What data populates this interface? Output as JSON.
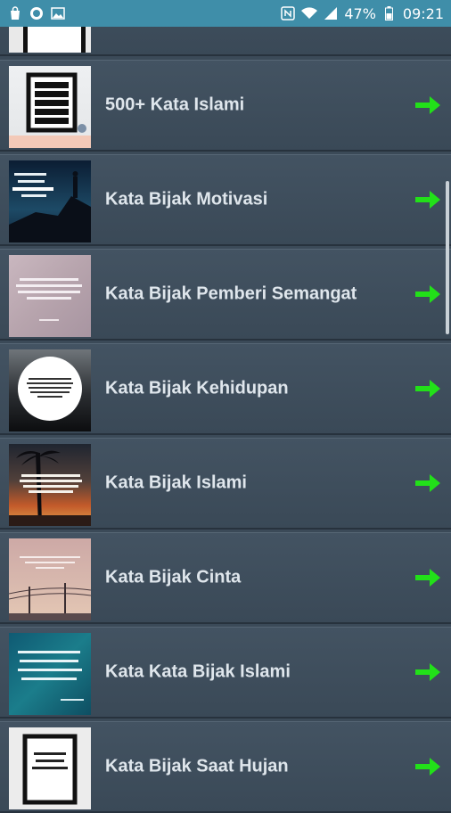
{
  "status_bar": {
    "battery_percent": "47%",
    "time": "09:21",
    "left_icons": [
      "shopping-bag-icon",
      "badge-icon",
      "image-icon"
    ],
    "right_icons": [
      "nfc-icon",
      "wifi-icon",
      "signal-icon",
      "battery-icon"
    ]
  },
  "list": {
    "items": [
      {
        "label": "500+ Kata Islami",
        "thumb": "kerja-kerja-poster"
      },
      {
        "label": "Kata Bijak Motivasi",
        "thumb": "silhouette-mountain"
      },
      {
        "label": "Kata Bijak Pemberi Semangat",
        "thumb": "pastel-quote"
      },
      {
        "label": "Kata Bijak Kehidupan",
        "thumb": "circle-quote-sea"
      },
      {
        "label": "Kata Bijak Islami",
        "thumb": "sunset-palm"
      },
      {
        "label": "Kata Bijak Cinta",
        "thumb": "pink-sky-wires"
      },
      {
        "label": "Kata Kata Bijak Islami",
        "thumb": "teal-script"
      },
      {
        "label": "Kata Bijak Saat Hujan",
        "thumb": "framed-script"
      }
    ]
  },
  "colors": {
    "status_bar": "#3f8ea9",
    "background": "#3b4a58",
    "arrow": "#22e019",
    "label": "#dfe6ec"
  }
}
